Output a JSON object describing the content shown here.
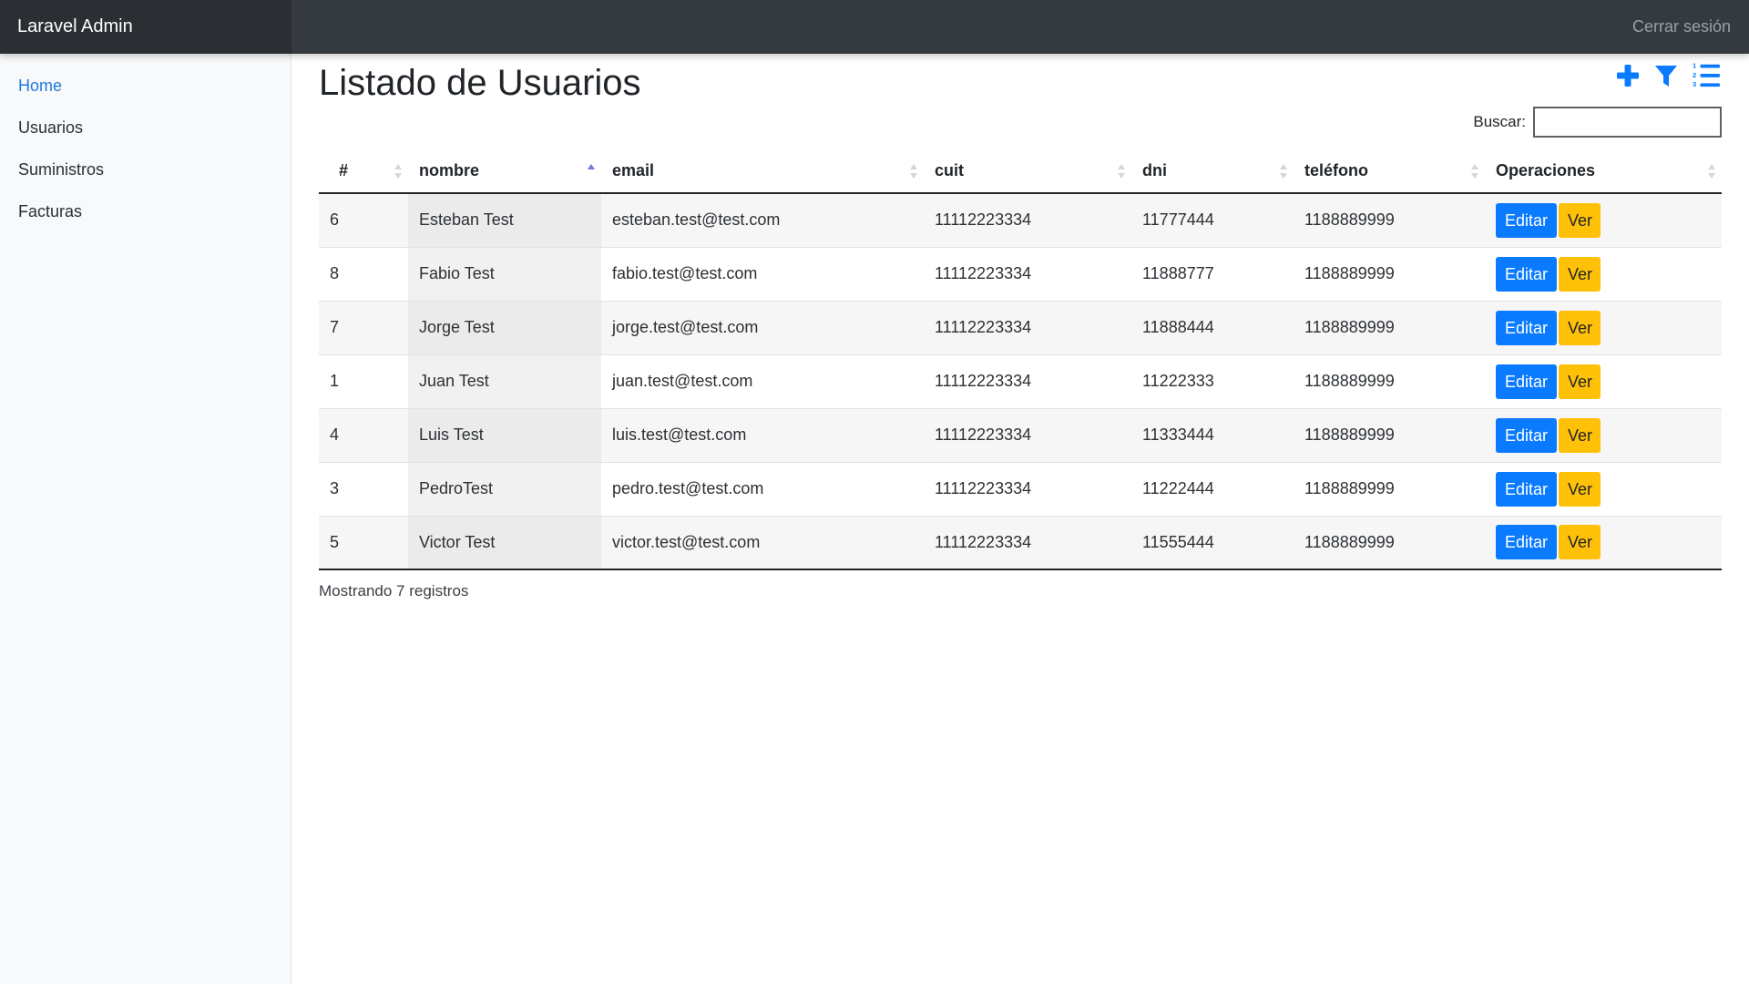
{
  "app": {
    "brand": "Laravel Admin",
    "logout_label": "Cerrar sesión"
  },
  "sidebar": {
    "items": [
      {
        "label": "Home",
        "active": true
      },
      {
        "label": "Usuarios",
        "active": false
      },
      {
        "label": "Suministros",
        "active": false
      },
      {
        "label": "Facturas",
        "active": false
      }
    ]
  },
  "main": {
    "title": "Listado de Usuarios",
    "toolbar": {
      "add_icon": "plus-icon",
      "filter_icon": "filter-icon",
      "list_icon": "ordered-list-icon"
    },
    "search": {
      "label": "Buscar:",
      "value": ""
    },
    "table": {
      "columns": [
        "#",
        "nombre",
        "email",
        "cuit",
        "dni",
        "teléfono",
        "Operaciones"
      ],
      "sorted_column": "nombre",
      "sort_direction": "asc",
      "rows": [
        {
          "id": "6",
          "nombre": "Esteban Test",
          "email": "esteban.test@test.com",
          "cuit": "11112223334",
          "dni": "11777444",
          "telefono": "1188889999"
        },
        {
          "id": "8",
          "nombre": "Fabio Test",
          "email": "fabio.test@test.com",
          "cuit": "11112223334",
          "dni": "11888777",
          "telefono": "1188889999"
        },
        {
          "id": "7",
          "nombre": "Jorge Test",
          "email": "jorge.test@test.com",
          "cuit": "11112223334",
          "dni": "11888444",
          "telefono": "1188889999"
        },
        {
          "id": "1",
          "nombre": "Juan Test",
          "email": "juan.test@test.com",
          "cuit": "11112223334",
          "dni": "11222333",
          "telefono": "1188889999"
        },
        {
          "id": "4",
          "nombre": "Luis Test",
          "email": "luis.test@test.com",
          "cuit": "11112223334",
          "dni": "11333444",
          "telefono": "1188889999"
        },
        {
          "id": "3",
          "nombre": "PedroTest",
          "email": "pedro.test@test.com",
          "cuit": "11112223334",
          "dni": "11222444",
          "telefono": "1188889999"
        },
        {
          "id": "5",
          "nombre": "Victor Test",
          "email": "victor.test@test.com",
          "cuit": "11112223334",
          "dni": "11555444",
          "telefono": "1188889999"
        }
      ],
      "actions": {
        "edit_label": "Editar",
        "view_label": "Ver"
      }
    },
    "info": "Mostrando 7 registros"
  },
  "colors": {
    "topbar": "#343a40",
    "brand_bg": "#2b2e32",
    "primary": "#0a7bff",
    "warning": "#ffc107",
    "link_active": "#1f7ae0"
  }
}
